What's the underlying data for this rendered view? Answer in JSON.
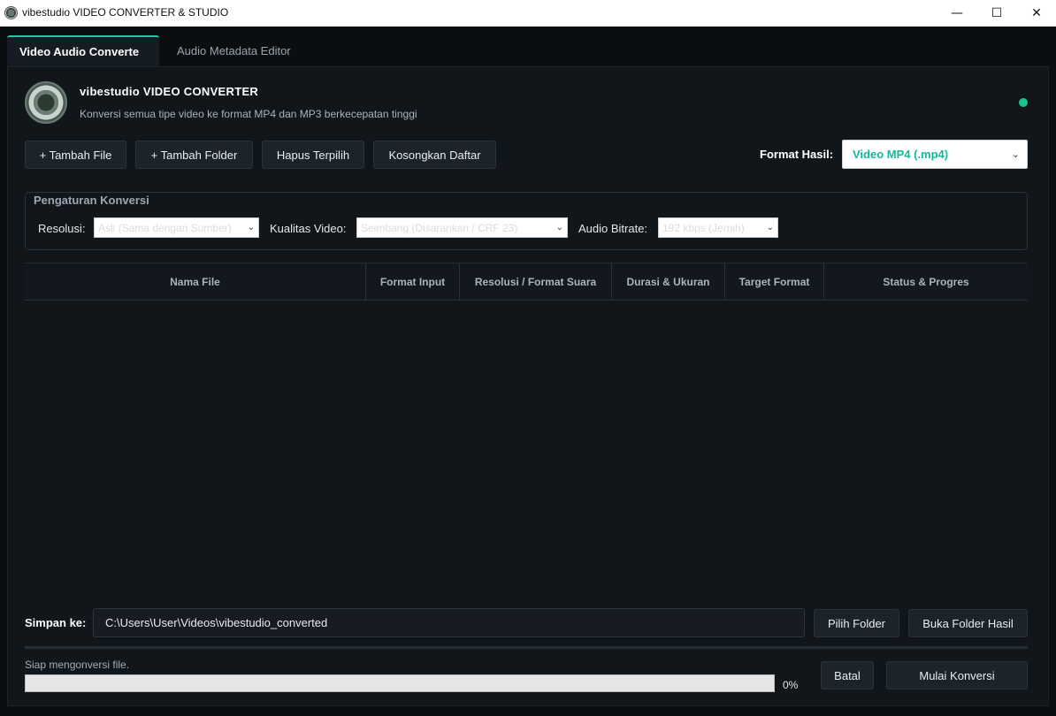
{
  "window": {
    "title": "vibestudio VIDEO CONVERTER & STUDIO",
    "minimize_glyph": "—",
    "maximize_glyph": "☐",
    "close_glyph": "✕"
  },
  "tabs": [
    {
      "label": "Video  Audio Converte",
      "active": true
    },
    {
      "label": "Audio Metadata Editor",
      "active": false
    }
  ],
  "header": {
    "title": "vibestudio VIDEO CONVERTER",
    "subtitle": "Konversi semua tipe video ke format MP4 dan MP3 berkecepatan tinggi",
    "status_color": "#18c68c"
  },
  "toolbar": {
    "add_file": "+ Tambah File",
    "add_folder": "+ Tambah Folder",
    "remove_selected": "Hapus Terpilih",
    "clear_list": "Kosongkan Daftar",
    "format_label": "Format Hasil:",
    "format_value": "Video MP4 (.mp4)"
  },
  "settings": {
    "title": "Pengaturan Konversi",
    "resolution_label": "Resolusi:",
    "resolution_value": "Asli (Sama dengan Sumber)",
    "quality_label": "Kualitas Video:",
    "quality_value": "Seimbang (Disarankan / CRF 23)",
    "bitrate_label": "Audio Bitrate:",
    "bitrate_value": "192 kbps (Jernih)"
  },
  "table": {
    "columns": [
      "Nama File",
      "Format Input",
      "Resolusi / Format Suara",
      "Durasi & Ukuran",
      "Target Format",
      "Status & Progres"
    ],
    "rows": []
  },
  "output": {
    "save_label": "Simpan ke:",
    "save_path": "C:\\Users\\User\\Videos\\vibestudio_converted",
    "choose_folder": "Pilih Folder",
    "open_folder": "Buka Folder Hasil"
  },
  "footer": {
    "status": "Siap mengonversi file.",
    "progress_fraction": 0,
    "progress_text": "0%",
    "cancel": "Batal",
    "start": "Mulai Konversi"
  },
  "colors": {
    "accent": "#1ec9a8",
    "background": "#0b0e11",
    "panel": "#11161b"
  }
}
